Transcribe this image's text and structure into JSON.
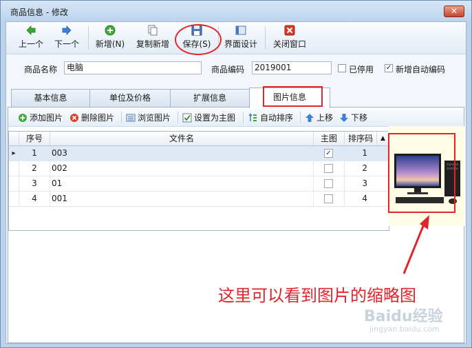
{
  "window": {
    "title": "商品信息 - 修改",
    "close_label": "✕"
  },
  "toolbar": {
    "prev": "上一个",
    "next": "下一个",
    "add": "新增(N)",
    "copy_add": "复制新增",
    "save": "保存(S)",
    "ui_design": "界面设计",
    "close_window": "关闭窗口"
  },
  "form": {
    "name_label": "商品名称",
    "name_value": "电脑",
    "code_label": "商品编码",
    "code_value": "2019001",
    "disabled_label": "已停用",
    "disabled_checked": false,
    "auto_code_label": "新增自动编码",
    "auto_code_checked": true
  },
  "tabs": [
    {
      "label": "基本信息",
      "active": false
    },
    {
      "label": "单位及价格",
      "active": false
    },
    {
      "label": "扩展信息",
      "active": false
    },
    {
      "label": "图片信息",
      "active": true
    }
  ],
  "image_toolbar": {
    "add_image": "添加图片",
    "delete_image": "删除图片",
    "browse_image": "浏览图片",
    "set_main": "设置为主图",
    "auto_sort": "自动排序",
    "move_up": "上移",
    "move_down": "下移"
  },
  "grid": {
    "columns": [
      "序号",
      "文件名",
      "主图",
      "排序码"
    ],
    "sort_indicator": "▲",
    "current_row_marker": "▸",
    "rows": [
      {
        "index": "1",
        "file": "003",
        "main": true,
        "sort": "1"
      },
      {
        "index": "2",
        "file": "002",
        "main": false,
        "sort": "2"
      },
      {
        "index": "3",
        "file": "01",
        "main": false,
        "sort": "3"
      },
      {
        "index": "4",
        "file": "001",
        "main": false,
        "sort": "4"
      }
    ]
  },
  "annotation_text": "这里可以看到图片的缩略图",
  "watermark": {
    "line1": "Baidu经验",
    "line2": "jingyan.baidu.com"
  },
  "colors": {
    "highlight_red": "#e0242a",
    "thumb_bg": "#fffde6",
    "window_blue": "#bcd2ea"
  }
}
